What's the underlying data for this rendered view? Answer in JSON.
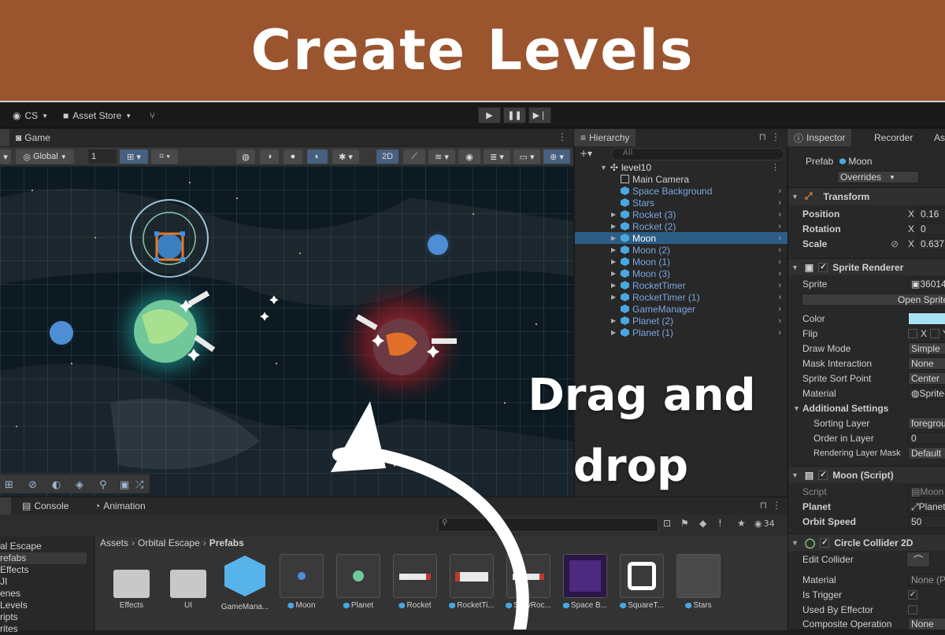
{
  "banner": {
    "title": "Create Levels"
  },
  "toolbar": {
    "account": "CS",
    "asset_store": "Asset Store"
  },
  "scene_tabs": {
    "game": "Game"
  },
  "scene_toolbar": {
    "global": "Global",
    "grid_value": "1",
    "mode_2d": "2D"
  },
  "hierarchy": {
    "title": "Hierarchy",
    "search_placeholder": "All",
    "scene": "level10",
    "items": [
      {
        "label": "Main Camera",
        "plain": true,
        "expand": false
      },
      {
        "label": "Space Background",
        "plain": false,
        "expand": false
      },
      {
        "label": "Stars",
        "plain": false,
        "expand": false
      },
      {
        "label": "Rocket (3)",
        "plain": false,
        "expand": true
      },
      {
        "label": "Rocket (2)",
        "plain": false,
        "expand": true
      },
      {
        "label": "Moon",
        "plain": false,
        "expand": true,
        "selected": true
      },
      {
        "label": "Moon (2)",
        "plain": false,
        "expand": true
      },
      {
        "label": "Moon (1)",
        "plain": false,
        "expand": true
      },
      {
        "label": "Moon (3)",
        "plain": false,
        "expand": true
      },
      {
        "label": "RocketTimer",
        "plain": false,
        "expand": true
      },
      {
        "label": "RocketTimer (1)",
        "plain": false,
        "expand": true
      },
      {
        "label": "GameManager",
        "plain": false,
        "expand": false
      },
      {
        "label": "Planet (2)",
        "plain": false,
        "expand": true
      },
      {
        "label": "Planet (1)",
        "plain": false,
        "expand": true
      }
    ]
  },
  "inspector": {
    "tab_inspector": "Inspector",
    "tab_recorder": "Recorder",
    "tab_other": "As",
    "prefab_label": "Prefab",
    "prefab_value": "Moon",
    "overrides": "Overrides",
    "transform": {
      "title": "Transform",
      "position_label": "Position",
      "position_x": "0.16",
      "rotation_label": "Rotation",
      "rotation_x": "0",
      "scale_label": "Scale",
      "scale_x": "0.637",
      "axis_x": "X"
    },
    "sprite_renderer": {
      "title": "Sprite Renderer",
      "sprite_label": "Sprite",
      "sprite_value": "36014",
      "open_sprite": "Open Sprite",
      "color_label": "Color",
      "color_value": "#a7e3f5",
      "flip_label": "Flip",
      "flip_x": "X",
      "flip_y": "Y",
      "draw_mode_label": "Draw Mode",
      "draw_mode_value": "Simple",
      "mask_label": "Mask Interaction",
      "mask_value": "None",
      "sort_point_label": "Sprite Sort Point",
      "sort_point_value": "Center",
      "material_label": "Material",
      "material_value": "Sprite-",
      "additional_label": "Additional Settings",
      "sorting_layer_label": "Sorting Layer",
      "sorting_layer_value": "foregrou",
      "order_label": "Order in Layer",
      "order_value": "0",
      "rendering_mask_label": "Rendering Layer Mask",
      "rendering_mask_value": "Default"
    },
    "moon_script": {
      "title": "Moon (Script)",
      "script_label": "Script",
      "script_value": "Moon",
      "planet_label": "Planet",
      "planet_value": "Planet",
      "orbit_label": "Orbit Speed",
      "orbit_value": "50"
    },
    "collider": {
      "title": "Circle Collider 2D",
      "edit_label": "Edit Collider",
      "material_label": "Material",
      "material_value": "None (Ph",
      "trigger_label": "Is Trigger",
      "effector_label": "Used By Effector",
      "composite_label": "Composite Operation",
      "composite_value": "None"
    }
  },
  "bottom": {
    "tab_console": "Console",
    "tab_animation": "Animation",
    "hidden_count": "34",
    "breadcrumb": [
      "Assets",
      "Orbital Escape",
      "Prefabs"
    ],
    "tree": [
      "al Escape",
      "refabs",
      "Effects",
      "JI",
      "enes",
      "Levels",
      "ripts",
      "rites"
    ],
    "assets": [
      {
        "label": "Effects",
        "kind": "folder"
      },
      {
        "label": "UI",
        "kind": "folder"
      },
      {
        "label": "GameMana...",
        "kind": "bigcube"
      },
      {
        "label": "Moon",
        "kind": "moon"
      },
      {
        "label": "Planet",
        "kind": "planet"
      },
      {
        "label": "Rocket",
        "kind": "rocket"
      },
      {
        "label": "RocketTi...",
        "kind": "rocket2"
      },
      {
        "label": "SlowRoc...",
        "kind": "rocket"
      },
      {
        "label": "Space B...",
        "kind": "space"
      },
      {
        "label": "SquareT...",
        "kind": "clock"
      },
      {
        "label": "Stars",
        "kind": "stars"
      }
    ]
  },
  "overlay": {
    "line1": "Drag and",
    "line2": "drop"
  }
}
